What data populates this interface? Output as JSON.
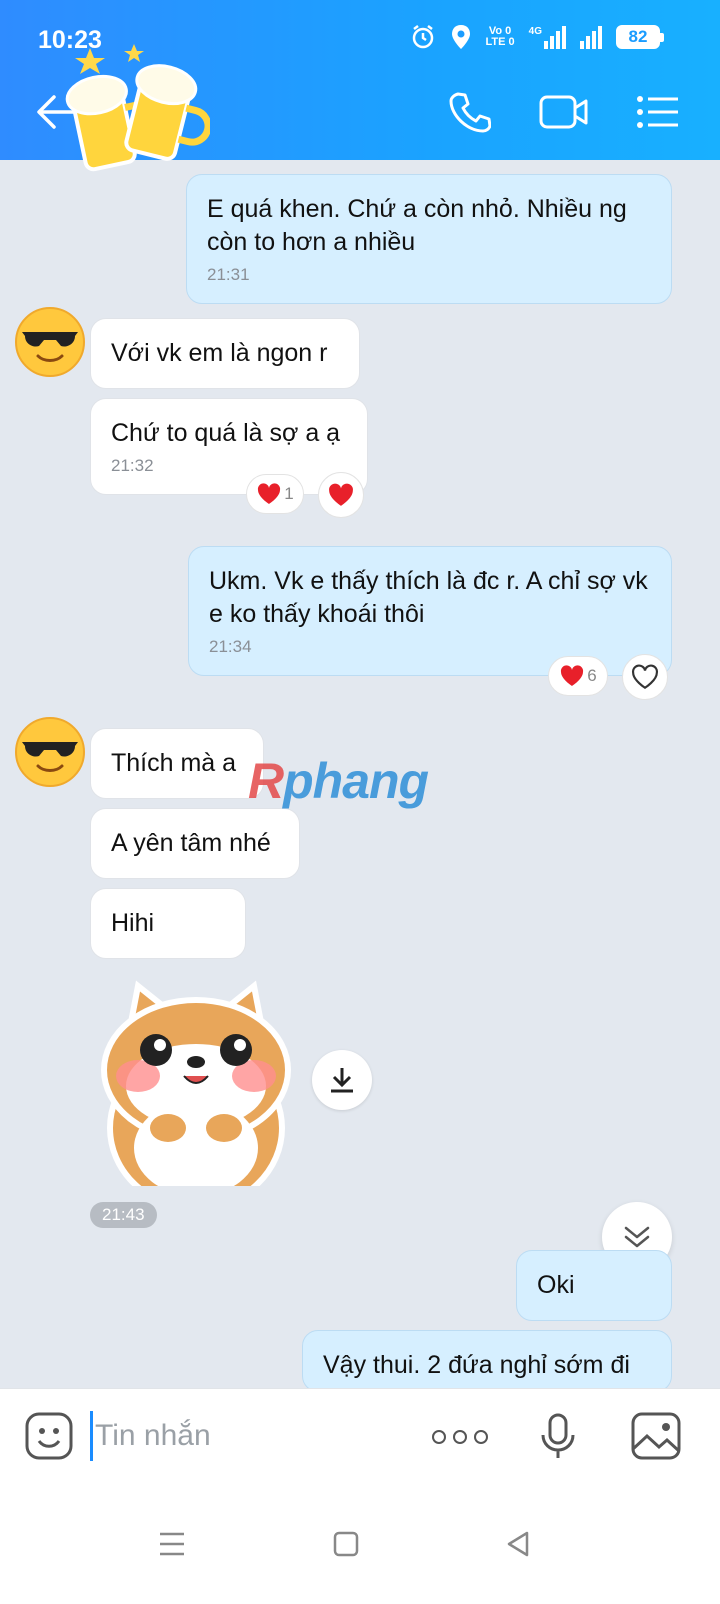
{
  "status_bar": {
    "time": "10:23",
    "network_top": "Vo 0",
    "network_bottom": "LTE 0",
    "network_gen": "4G",
    "battery": "82"
  },
  "header": {
    "icons": [
      "back-arrow-icon",
      "phone-icon",
      "video-call-icon",
      "menu-list-icon"
    ],
    "accent": "#1a9cff"
  },
  "messages": {
    "m1": {
      "text": "E quá khen. Chứ a còn nhỏ. Nhiều ng còn to hơn a nhiều",
      "time": "21:31"
    },
    "m2": {
      "text": "Với vk em là ngon r"
    },
    "m3": {
      "text": "Chứ to quá là sợ a ạ",
      "time": "21:32",
      "reaction_count": "1"
    },
    "m4": {
      "text": "Ukm. Vk e thấy thích là đc r. A chỉ sợ vk e ko thấy khoái thôi",
      "time": "21:34",
      "reaction_count": "6"
    },
    "m5": {
      "text": "Thích mà a"
    },
    "m6": {
      "text": "A yên tâm nhé"
    },
    "m7": {
      "text": "Hihi"
    },
    "sticker_time": "21:43",
    "m8": {
      "text": "Oki"
    },
    "m9": {
      "text": "Vậy thui. 2 đứa nghỉ sớm đi"
    }
  },
  "watermark": {
    "first": "R",
    "rest": "phang"
  },
  "input": {
    "placeholder": "Tin nhắn"
  }
}
